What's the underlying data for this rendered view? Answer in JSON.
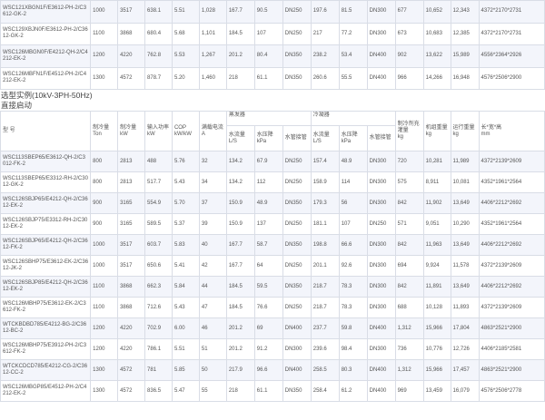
{
  "top_rows": [
    {
      "model": "WSC121XBGN1F/E3612-PH-2/C3612-GK-2",
      "ton": "1000",
      "kw": "3517",
      "input": "638.1",
      "cop": "5.51",
      "rla": "1,028",
      "evap_flow": "167.7",
      "evap_drop": "90.5",
      "evap_pipe": "DN250",
      "cond_flow": "197.6",
      "cond_drop": "81.5",
      "cond_pipe": "DN300",
      "charge": "677",
      "unit_weight": "10,652",
      "oper_weight": "12,343",
      "dims": "4372*2170*2731"
    },
    {
      "model": "WSC129XBJN0F/E3612-PH-2/C3612-GK-2",
      "ton": "1100",
      "kw": "3868",
      "input": "680.4",
      "cop": "5.68",
      "rla": "1,101",
      "evap_flow": "184.5",
      "evap_drop": "107",
      "evap_pipe": "DN250",
      "cond_flow": "217",
      "cond_drop": "77.2",
      "cond_pipe": "DN300",
      "charge": "673",
      "unit_weight": "10,683",
      "oper_weight": "12,385",
      "dims": "4372*2170*2731"
    },
    {
      "model": "WSC126MBGN0F/E4212-QH-2/C4212-EK-2",
      "ton": "1200",
      "kw": "4220",
      "input": "762.8",
      "cop": "5.53",
      "rla": "1,267",
      "evap_flow": "201.2",
      "evap_drop": "80.4",
      "evap_pipe": "DN350",
      "cond_flow": "238.2",
      "cond_drop": "53.4",
      "cond_pipe": "DN400",
      "charge": "902",
      "unit_weight": "13,622",
      "oper_weight": "15,989",
      "dims": "4556*2364*2926"
    },
    {
      "model": "WSC126MBFN1F/E4512-PH-2/C4212-EK-2",
      "ton": "1300",
      "kw": "4572",
      "input": "878.7",
      "cop": "5.20",
      "rla": "1,460",
      "evap_flow": "218",
      "evap_drop": "61.1",
      "evap_pipe": "DN350",
      "cond_flow": "260.6",
      "cond_drop": "55.5",
      "cond_pipe": "DN400",
      "charge": "966",
      "unit_weight": "14,266",
      "oper_weight": "16,948",
      "dims": "4576*2506*2900"
    }
  ],
  "section_title": "选型实例(10kV-3PH-50Hz)",
  "section_subtitle": "直接启动",
  "headers": {
    "model": "型 号",
    "capacity_ton": "制冷量",
    "capacity_ton_unit": "Ton",
    "capacity_kw": "制冷量",
    "capacity_kw_unit": "kW",
    "input_power": "输入功率",
    "input_power_unit": "kW",
    "cop": "COP",
    "cop_unit": "kW/kW",
    "rla": "满载电流",
    "rla_unit": "A",
    "evaporator": "蒸发器",
    "evap_flow": "水流量L/S",
    "evap_drop": "水压降",
    "evap_drop_unit": "kPa",
    "evap_pipe": "水管接管",
    "condenser": "冷凝器",
    "cond_flow": "水流量L/S",
    "cond_drop": "水压降",
    "cond_drop_unit": "kPa",
    "cond_pipe": "水管接管",
    "charge": "制冷剂充灌量",
    "charge_unit": "kg",
    "unit_weight": "机组重量",
    "unit_weight_unit": "kg",
    "oper_weight": "运行重量",
    "oper_weight_unit": "kg",
    "dims": "长*宽*高",
    "dims_unit": "mm"
  },
  "rows": [
    {
      "model": "WSC113SBEP65/E3612-QH-2/C3012-FK-2",
      "ton": "800",
      "kw": "2813",
      "input": "488",
      "cop": "5.76",
      "rla": "32",
      "evap_flow": "134.2",
      "evap_drop": "67.9",
      "evap_pipe": "DN250",
      "cond_flow": "157.4",
      "cond_drop": "48.9",
      "cond_pipe": "DN300",
      "charge": "720",
      "unit_weight": "10,281",
      "oper_weight": "11,989",
      "dims": "4372*2139*2609"
    },
    {
      "model": "WSC113SBEP65/E3312-RH-2/C3012-GK-2",
      "ton": "800",
      "kw": "2813",
      "input": "517.7",
      "cop": "5.43",
      "rla": "34",
      "evap_flow": "134.2",
      "evap_drop": "112",
      "evap_pipe": "DN250",
      "cond_flow": "158.9",
      "cond_drop": "114",
      "cond_pipe": "DN300",
      "charge": "575",
      "unit_weight": "8,911",
      "oper_weight": "10,081",
      "dims": "4352*1961*2564"
    },
    {
      "model": "WSC126SBJP65/E4212-QH-2/C3612-EK-2",
      "ton": "900",
      "kw": "3165",
      "input": "554.9",
      "cop": "5.70",
      "rla": "37",
      "evap_flow": "150.9",
      "evap_drop": "48.9",
      "evap_pipe": "DN350",
      "cond_flow": "179.3",
      "cond_drop": "56",
      "cond_pipe": "DN300",
      "charge": "842",
      "unit_weight": "11,902",
      "oper_weight": "13,649",
      "dims": "4406*2212*2692"
    },
    {
      "model": "WSC126SBJP75/E3312-RH-2/C3012-EK-2",
      "ton": "900",
      "kw": "3165",
      "input": "589.5",
      "cop": "5.37",
      "rla": "39",
      "evap_flow": "150.9",
      "evap_drop": "137",
      "evap_pipe": "DN250",
      "cond_flow": "181.1",
      "cond_drop": "107",
      "cond_pipe": "DN250",
      "charge": "571",
      "unit_weight": "9,051",
      "oper_weight": "10,290",
      "dims": "4352*1961*2564"
    },
    {
      "model": "WSC126SBJP65/E4212-QH-2/C3612-FK-2",
      "ton": "1000",
      "kw": "3517",
      "input": "603.7",
      "cop": "5.83",
      "rla": "40",
      "evap_flow": "167.7",
      "evap_drop": "58.7",
      "evap_pipe": "DN350",
      "cond_flow": "198.8",
      "cond_drop": "66.6",
      "cond_pipe": "DN300",
      "charge": "842",
      "unit_weight": "11,963",
      "oper_weight": "13,649",
      "dims": "4406*2212*2692"
    },
    {
      "model": "WSC126SBHP75/E3612-EK-2/C3612-JK-2",
      "ton": "1000",
      "kw": "3517",
      "input": "650.6",
      "cop": "5.41",
      "rla": "42",
      "evap_flow": "167.7",
      "evap_drop": "64",
      "evap_pipe": "DN250",
      "cond_flow": "201.1",
      "cond_drop": "92.6",
      "cond_pipe": "DN300",
      "charge": "694",
      "unit_weight": "9,924",
      "oper_weight": "11,578",
      "dims": "4372*2139*2609"
    },
    {
      "model": "WSC126SBJP85/E4212-QH-2/C3612-EK-2",
      "ton": "1100",
      "kw": "3868",
      "input": "662.3",
      "cop": "5.84",
      "rla": "44",
      "evap_flow": "184.5",
      "evap_drop": "59.5",
      "evap_pipe": "DN350",
      "cond_flow": "218.7",
      "cond_drop": "78.3",
      "cond_pipe": "DN300",
      "charge": "842",
      "unit_weight": "11,891",
      "oper_weight": "13,649",
      "dims": "4406*2212*2692"
    },
    {
      "model": "WSC126MBHP75/E3612-EK-2/C3612-FK-2",
      "ton": "1100",
      "kw": "3868",
      "input": "712.6",
      "cop": "5.43",
      "rla": "47",
      "evap_flow": "184.5",
      "evap_drop": "76.6",
      "evap_pipe": "DN250",
      "cond_flow": "218.7",
      "cond_drop": "78.3",
      "cond_pipe": "DN300",
      "charge": "688",
      "unit_weight": "10,128",
      "oper_weight": "11,893",
      "dims": "4372*2139*2609"
    },
    {
      "model": "WTCKBDBD785/E4212-BG-2/C3612-BC-2",
      "ton": "1200",
      "kw": "4220",
      "input": "702.9",
      "cop": "6.00",
      "rla": "46",
      "evap_flow": "201.2",
      "evap_drop": "69",
      "evap_pipe": "DN400",
      "cond_flow": "237.7",
      "cond_drop": "59.8",
      "cond_pipe": "DN400",
      "charge": "1,312",
      "unit_weight": "15,966",
      "oper_weight": "17,804",
      "dims": "4863*2521*2900"
    },
    {
      "model": "WSC126MBHP75/E3912-PH-2/C3612-FK-2",
      "ton": "1200",
      "kw": "4220",
      "input": "786.1",
      "cop": "5.51",
      "rla": "51",
      "evap_flow": "201.2",
      "evap_drop": "91.2",
      "evap_pipe": "DN300",
      "cond_flow": "239.6",
      "cond_drop": "98.4",
      "cond_pipe": "DN300",
      "charge": "736",
      "unit_weight": "10,776",
      "oper_weight": "12,726",
      "dims": "4406*2185*2581"
    },
    {
      "model": "WTCKCDCD785/E4212-CG-2/C3612-CC-2",
      "ton": "1300",
      "kw": "4572",
      "input": "781",
      "cop": "5.85",
      "rla": "50",
      "evap_flow": "217.9",
      "evap_drop": "96.6",
      "evap_pipe": "DN400",
      "cond_flow": "258.5",
      "cond_drop": "80.3",
      "cond_pipe": "DN400",
      "charge": "1,312",
      "unit_weight": "15,966",
      "oper_weight": "17,457",
      "dims": "4863*2521*2900"
    },
    {
      "model": "WSC126MBGP85/E4512-PH-2/C4212-EK-2",
      "ton": "1300",
      "kw": "4572",
      "input": "836.5",
      "cop": "5.47",
      "rla": "55",
      "evap_flow": "218",
      "evap_drop": "61.1",
      "evap_pipe": "DN350",
      "cond_flow": "258.4",
      "cond_drop": "61.2",
      "cond_pipe": "DN400",
      "charge": "969",
      "unit_weight": "13,459",
      "oper_weight": "16,079",
      "dims": "4576*2506*2778"
    }
  ]
}
